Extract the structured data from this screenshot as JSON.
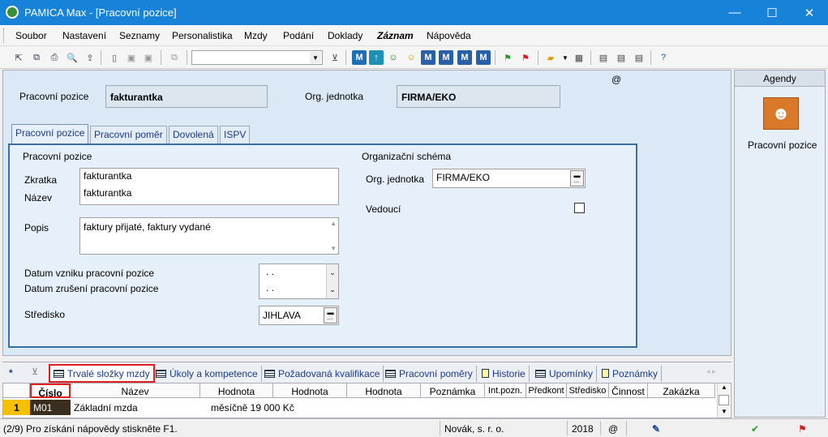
{
  "window": {
    "title": "PAMICA Max - [Pracovní pozice]",
    "minimize": "—",
    "maximize": "☐",
    "close": "✕"
  },
  "menu": [
    "Soubor",
    "Nastavení",
    "Seznamy",
    "Personalistika",
    "Mzdy",
    "Podání",
    "Doklady",
    "Záznam",
    "Nápověda"
  ],
  "header": {
    "position_label": "Pracovní pozice",
    "position_value": "fakturantka",
    "org_label": "Org. jednotka",
    "org_value": "FIRMA/EKO",
    "at_symbol": "@"
  },
  "tabs": [
    "Pracovní pozice",
    "Pracovní poměr",
    "Dovolená",
    "ISPV"
  ],
  "form": {
    "group_title": "Pracovní pozice",
    "zkratka_label": "Zkratka",
    "zkratka_value": "fakturantka",
    "nazev_label": "Název",
    "nazev_value": "fakturantka",
    "popis_label": "Popis",
    "popis_value": "faktury přijaté, faktury vydané",
    "datum_vzniku_label": "Datum vzniku pracovní pozice",
    "datum_vzniku_value": " .  .",
    "datum_zruseni_label": "Datum zrušení pracovní pozice",
    "datum_zruseni_value": " .  .",
    "stredisko_label": "Středisko",
    "stredisko_value": "JIHLAVA",
    "org_group_title": "Organizační schéma",
    "org_label": "Org. jednotka",
    "org_value": "FIRMA/EKO",
    "vedouci_label": "Vedoucí"
  },
  "agendy": {
    "title": "Agendy",
    "item": "Pracovní pozice"
  },
  "bottom_tabs": [
    "Trvalé složky mzdy",
    "Úkoly a kompetence",
    "Požadovaná kvalifikace",
    "Pracovní poměry",
    "Historie",
    "Upomínky",
    "Poznámky"
  ],
  "bottom_star": "*",
  "grid": {
    "columns": [
      "Číslo",
      "Název",
      "Hodnota",
      "Hodnota",
      "Hodnota",
      "Poznámka",
      "Int.pozn.",
      "Předkont",
      "Středisko",
      "Činnost",
      "Zakázka"
    ],
    "rows": [
      {
        "num": "1",
        "cislo": "M01",
        "nazev": "Základní mzda",
        "hodnota": "měsíčně 19 000 Kč"
      }
    ]
  },
  "status": {
    "help": "(2/9) Pro získání nápovědy stiskněte F1.",
    "company": "Novák, s. r. o.",
    "year": "2018",
    "at": "@"
  },
  "colors": {
    "titlebar": "#1683d8",
    "accent": "#3a6ea5",
    "highlight": "#e02020"
  }
}
